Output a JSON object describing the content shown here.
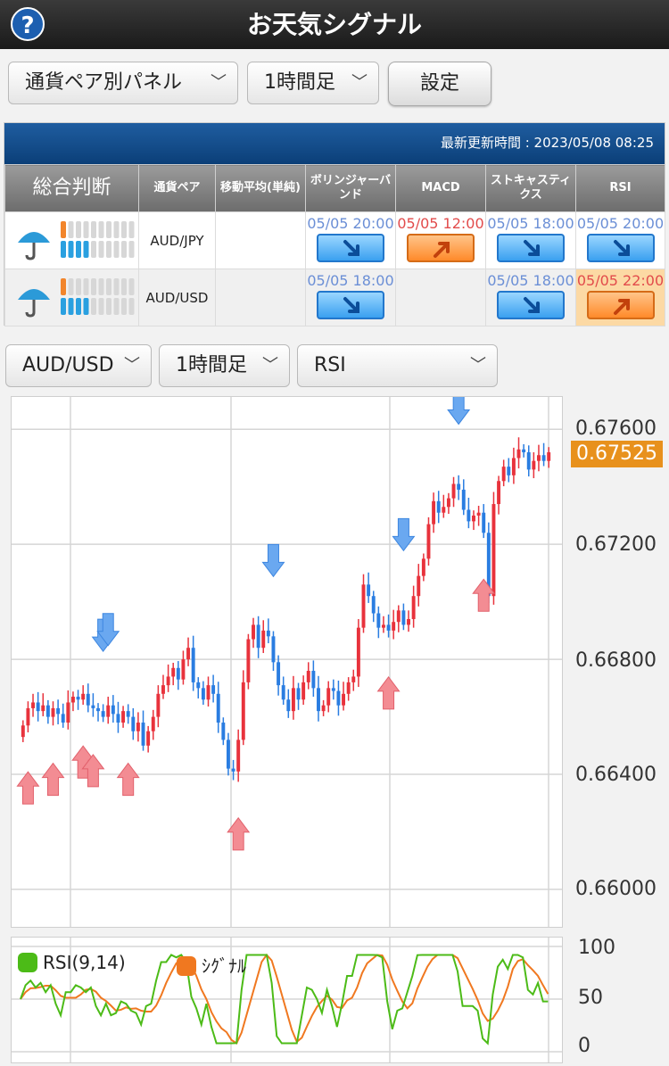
{
  "header": {
    "title": "お天気シグナル",
    "help_icon": "?"
  },
  "controls": {
    "panel_select": "通貨ペア別パネル",
    "timeframe_select": "1時間足",
    "settings_button": "設定"
  },
  "panel": {
    "updated_text": "最新更新時間 : 2023/05/08 08:25",
    "headers": [
      "総合判断",
      "通貨ペア",
      "移動平均(単純)",
      "ボリンジャーバンド",
      "MACD",
      "ストキャスティクス",
      "RSI"
    ],
    "rows": [
      {
        "pair": "AUD/JPY",
        "weather_icon": "umbrella-icon",
        "meter": {
          "orange": 1,
          "blue_top": 0,
          "blue_bottom": 4,
          "total": 10
        },
        "signals": {
          "moving_average": null,
          "bollinger": {
            "time": "05/05 20:00",
            "dir": "down"
          },
          "macd": {
            "time": "05/05 12:00",
            "dir": "up"
          },
          "stochastics": {
            "time": "05/05 18:00",
            "dir": "down"
          },
          "rsi": {
            "time": "05/05 20:00",
            "dir": "down"
          }
        }
      },
      {
        "pair": "AUD/USD",
        "weather_icon": "umbrella-icon",
        "meter": {
          "orange": 1,
          "blue_top": 0,
          "blue_bottom": 4,
          "total": 10
        },
        "signals": {
          "moving_average": null,
          "bollinger": {
            "time": "05/05 18:00",
            "dir": "down"
          },
          "macd": null,
          "stochastics": {
            "time": "05/05 18:00",
            "dir": "down"
          },
          "rsi": {
            "time": "05/05 22:00",
            "dir": "up",
            "highlight": true
          }
        }
      }
    ]
  },
  "chart_controls": {
    "pair_select": "AUD/USD",
    "timeframe_select": "1時間足",
    "indicator_select": "RSI"
  },
  "colors": {
    "up": "#e8323c",
    "down": "#2a7de1",
    "accent": "#e8911d",
    "rsi": "#4cbb17",
    "signal": "#f07820"
  },
  "chart_data": [
    {
      "type": "candlestick",
      "ylim": [
        0.66,
        0.677
      ],
      "y_ticks": [
        "0.67600",
        "0.67200",
        "0.66800",
        "0.66400",
        "0.66000"
      ],
      "current_price": "0.67525",
      "closes": [
        0.6657,
        0.6663,
        0.6665,
        0.6662,
        0.6664,
        0.666,
        0.6663,
        0.6661,
        0.6658,
        0.6665,
        0.6667,
        0.6666,
        0.6668,
        0.6664,
        0.6663,
        0.6662,
        0.666,
        0.6664,
        0.6661,
        0.6658,
        0.6662,
        0.666,
        0.6655,
        0.6658,
        0.665,
        0.6655,
        0.666,
        0.6668,
        0.6671,
        0.6674,
        0.6677,
        0.6673,
        0.668,
        0.6684,
        0.6672,
        0.667,
        0.6666,
        0.6671,
        0.6668,
        0.6658,
        0.6652,
        0.6642,
        0.6641,
        0.6652,
        0.6672,
        0.6687,
        0.6692,
        0.6684,
        0.669,
        0.6688,
        0.6679,
        0.6671,
        0.6666,
        0.6662,
        0.667,
        0.6666,
        0.6672,
        0.6676,
        0.667,
        0.6662,
        0.6664,
        0.667,
        0.6669,
        0.6664,
        0.6668,
        0.6672,
        0.6674,
        0.6691,
        0.6706,
        0.6702,
        0.6696,
        0.6691,
        0.6692,
        0.669,
        0.6693,
        0.6697,
        0.6692,
        0.6694,
        0.6702,
        0.6709,
        0.6715,
        0.6727,
        0.6735,
        0.6731,
        0.6733,
        0.6736,
        0.6741,
        0.6739,
        0.6732,
        0.6728,
        0.673,
        0.6731,
        0.6724,
        0.6702,
        0.6734,
        0.6742,
        0.6747,
        0.6744,
        0.675,
        0.6753,
        0.6752,
        0.6746,
        0.6749,
        0.6751,
        0.6749,
        0.6752
      ],
      "sell_signals": [
        16,
        17,
        50,
        76,
        87
      ],
      "buy_signals": [
        1,
        6,
        12,
        14,
        21,
        43,
        73,
        92
      ]
    },
    {
      "type": "line",
      "title": "RSI",
      "ylim": [
        0,
        100
      ],
      "y_ticks": [
        "100",
        "50",
        "0"
      ],
      "series": [
        {
          "name": "RSI(9,14)",
          "color": "#4cbb17"
        },
        {
          "name": "ｼｸﾞﾅﾙ",
          "color": "#f07820"
        }
      ]
    }
  ]
}
